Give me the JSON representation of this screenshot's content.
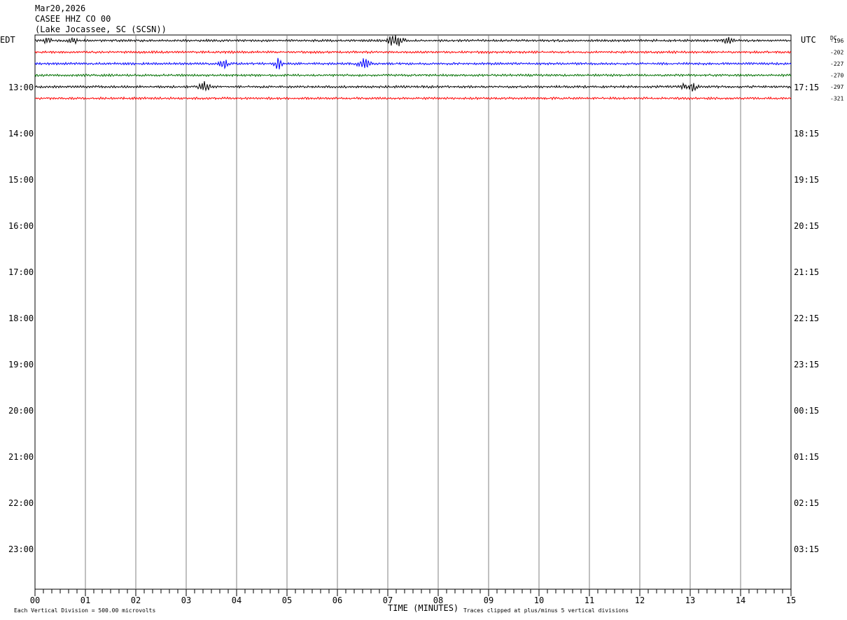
{
  "header": {
    "date": "Mar20,2026",
    "station": "CASEE HHZ CO 00",
    "location": "(Lake Jocassee, SC (SCSN))"
  },
  "chart_data": {
    "type": "helicorder",
    "left_axis_title": "EDT",
    "right_axis_title": "UTC",
    "dc_label": "DC",
    "rows_local": [
      "13:00",
      "14:00",
      "15:00",
      "16:00",
      "17:00",
      "18:00",
      "19:00",
      "20:00",
      "21:00",
      "22:00",
      "23:00"
    ],
    "rows_utc": [
      "17:15",
      "18:15",
      "19:15",
      "20:15",
      "21:15",
      "22:15",
      "23:15",
      "00:15",
      "01:15",
      "02:15",
      "03:15"
    ],
    "x_ticks": [
      "00",
      "01",
      "02",
      "03",
      "04",
      "05",
      "06",
      "07",
      "08",
      "09",
      "10",
      "11",
      "12",
      "13",
      "14",
      "15"
    ],
    "xlim": [
      0,
      15
    ],
    "xlabel": "TIME (MINUTES)",
    "scale_note": "Each Vertical Division =  500.00 microvolts",
    "clip_note": "Traces clipped at plus/minus 5 vertical divisions",
    "traces": [
      {
        "color": "#000000",
        "dc": "-196",
        "events": [
          [
            0.15,
            0.35,
            1.5
          ],
          [
            0.6,
            0.9,
            1.2
          ],
          [
            6.9,
            7.4,
            2.6
          ],
          [
            13.6,
            13.9,
            1.4
          ]
        ]
      },
      {
        "color": "#ff0000",
        "dc": "-202",
        "events": []
      },
      {
        "color": "#0000ff",
        "dc": "-227",
        "events": [
          [
            3.6,
            3.9,
            2.2
          ],
          [
            4.7,
            4.95,
            2.6
          ],
          [
            6.35,
            6.7,
            2.0
          ]
        ]
      },
      {
        "color": "#007000",
        "dc": "-270",
        "events": []
      },
      {
        "color": "#000000",
        "dc": "-297",
        "events": [
          [
            3.2,
            3.5,
            2.4
          ],
          [
            12.75,
            13.2,
            2.8
          ]
        ]
      },
      {
        "color": "#ff0000",
        "dc": "-321",
        "events": []
      }
    ]
  }
}
